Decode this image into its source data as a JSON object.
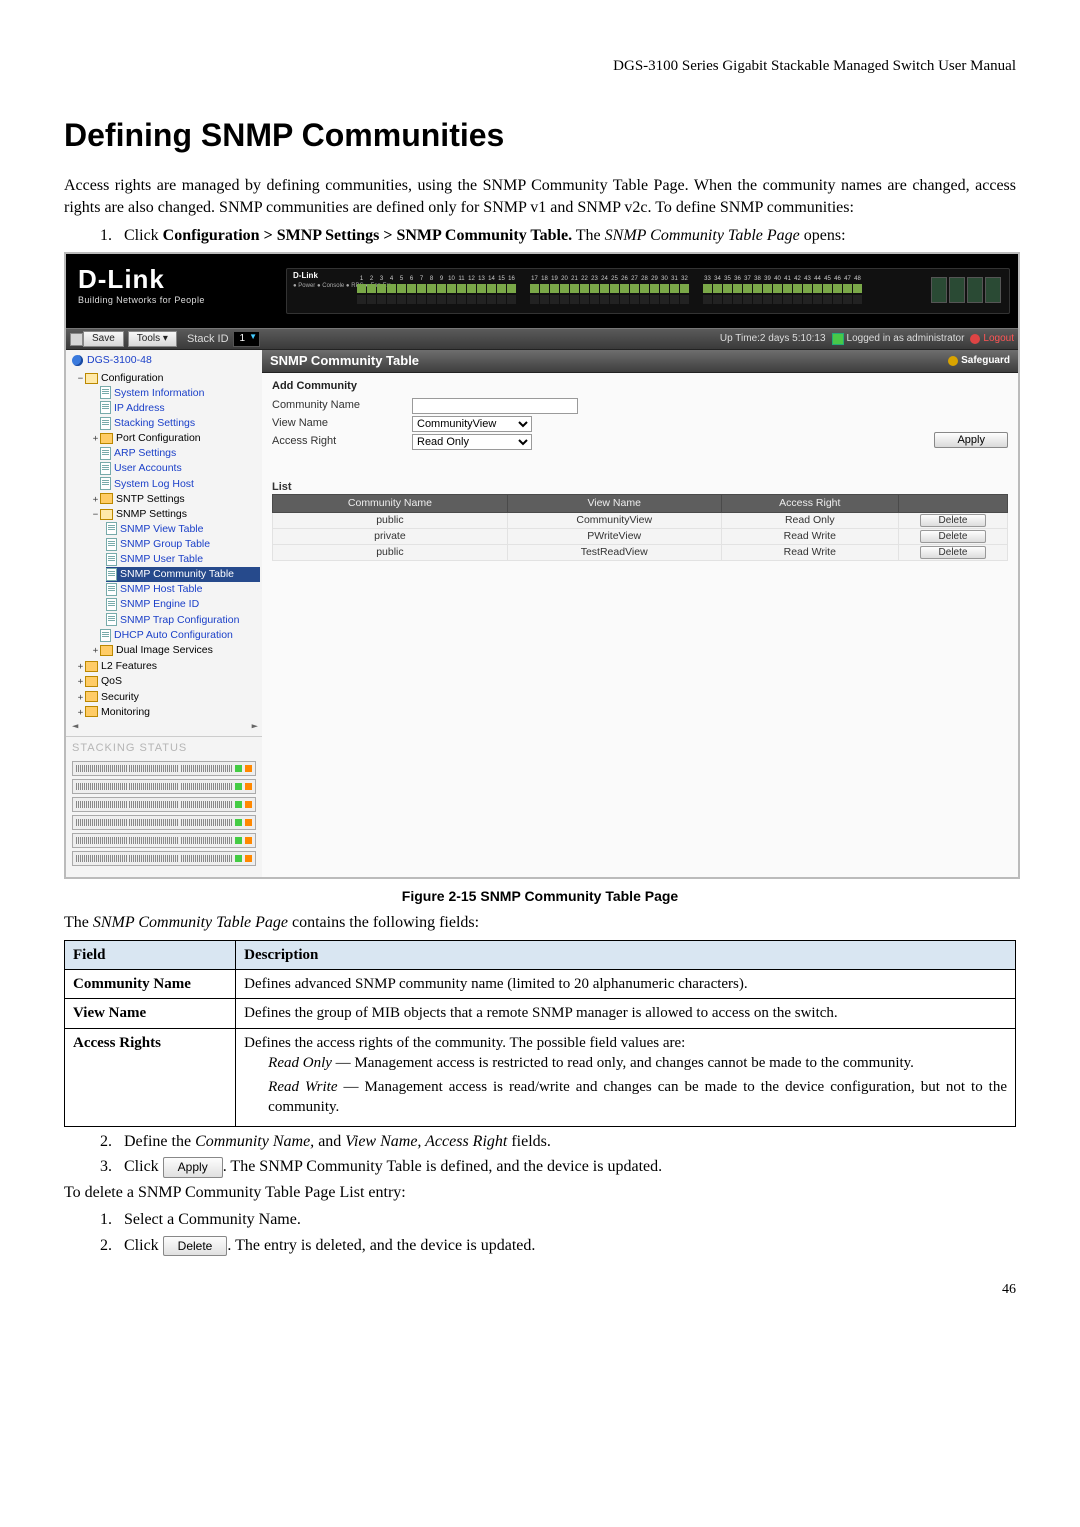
{
  "runhead": "DGS-3100 Series Gigabit Stackable Managed Switch User Manual",
  "title": "Defining SNMP Communities",
  "intro": "Access rights are managed by defining communities, using the SNMP Community Table Page. When the community names are changed, access rights are also changed. SNMP communities are defined only for SNMP v1 and SNMP v2c. To define SNMP communities:",
  "step1_pre": "Click ",
  "step1_bold": "Configuration > SMNP Settings > SNMP Community Table.",
  "step1_post": " The ",
  "step1_italic": "SNMP Community Table Page",
  "step1_end": " opens:",
  "fig_caption": "Figure 2-15 SNMP Community Table Page",
  "after_fig": "The SNMP Community Table Page contains the following fields:",
  "fields_table": {
    "hdr_field": "Field",
    "hdr_desc": "Description",
    "rows": [
      {
        "f": "Community Name",
        "d": "Defines advanced SNMP community name (limited to 20 alphanumeric characters)."
      },
      {
        "f": "View Name",
        "d": "Defines the group of MIB objects that a remote SNMP manager is allowed to access on the switch."
      }
    ],
    "access": {
      "f": "Access Rights",
      "lead": "Defines the access rights of the community. The possible field values are:",
      "ro_label": "Read Only",
      "ro_text": " — Management access is restricted to read only, and changes cannot be made to the community.",
      "rw_label": "Read Write",
      "rw_text": " — Management access is read/write and changes can be made to the device configuration, but not to the community."
    }
  },
  "step2_pre": "Define the ",
  "step2_i1": "Community Name,",
  "step2_mid": " and ",
  "step2_i2": "View Name, Access Right",
  "step2_end": " fields.",
  "step3_pre": "Click",
  "apply_btn": "Apply",
  "step3_post": ". The SNMP Community Table is defined, and the device is updated.",
  "delete_intro": "To delete a SNMP Community Table Page List entry:",
  "del_step1": "Select a Community Name.",
  "del_step2_pre": "Click",
  "delete_btn": "Delete",
  "del_step2_post": ". The entry is deleted, and the device is updated.",
  "pagenum": "46",
  "screenshot": {
    "logo": "D-Link",
    "tagline": "Building Networks for People",
    "rack_label": "D-Link",
    "rack_leds": "● Power\n● Console\n● RPS\n● Fan Err",
    "rack_model": "DGS-3100-48",
    "toolbar": {
      "save": "Save",
      "tools": "Tools ▾",
      "stackid_label": "Stack ID",
      "stackid_value": "1",
      "uptime": "Up Time:2 days 5:10:13",
      "logged": "Logged in as administrator",
      "logout": "Logout"
    },
    "tree": {
      "device": "DGS-3100-48",
      "configuration": "Configuration",
      "system_info": "System Information",
      "ip_address": "IP Address",
      "stacking_settings": "Stacking Settings",
      "port_config": "Port Configuration",
      "arp_settings": "ARP Settings",
      "user_accounts": "User Accounts",
      "system_log_host": "System Log Host",
      "sntp_settings": "SNTP Settings",
      "snmp_settings": "SNMP Settings",
      "snmp_view": "SNMP View Table",
      "snmp_group": "SNMP Group Table",
      "snmp_user": "SNMP User Table",
      "snmp_community": "SNMP Community Table",
      "snmp_host": "SNMP Host Table",
      "snmp_engine": "SNMP Engine ID",
      "snmp_trap": "SNMP Trap Configuration",
      "dhcp_auto": "DHCP Auto Configuration",
      "dual_image": "Dual Image Services",
      "l2": "L2 Features",
      "qos": "QoS",
      "security": "Security",
      "monitoring": "Monitoring",
      "stacking_status": "STACKING STATUS"
    },
    "panel": {
      "title": "SNMP Community Table",
      "safeguard": "Safeguard",
      "add_title": "Add Community",
      "lbl_community": "Community Name",
      "lbl_view": "View Name",
      "lbl_access": "Access Right",
      "sel_view": "CommunityView",
      "sel_access": "Read Only",
      "apply": "Apply",
      "list_title": "List",
      "cols": {
        "c": "Community Name",
        "v": "View Name",
        "a": "Access Right"
      },
      "rows": [
        {
          "c": "public",
          "v": "CommunityView",
          "a": "Read Only",
          "del": "Delete"
        },
        {
          "c": "private",
          "v": "PWriteView",
          "a": "Read Write",
          "del": "Delete"
        },
        {
          "c": "public",
          "v": "TestReadView",
          "a": "Read Write",
          "del": "Delete"
        }
      ]
    }
  }
}
